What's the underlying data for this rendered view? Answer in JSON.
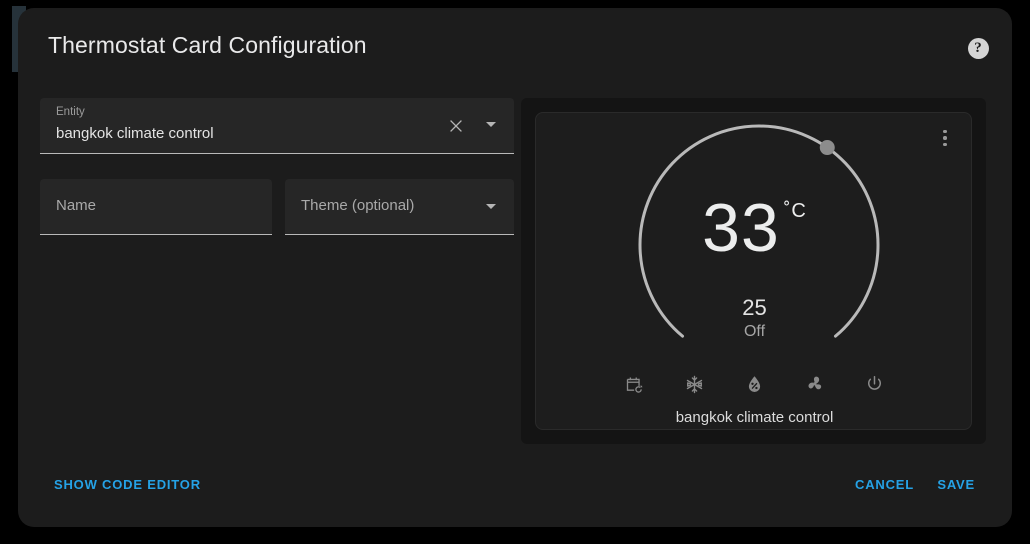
{
  "dialog": {
    "title": "Thermostat Card Configuration",
    "help_icon": "help-circle-icon",
    "help_glyph": "?"
  },
  "form": {
    "entity": {
      "label": "Entity",
      "value": "bangkok climate control",
      "clear_icon": "close-icon",
      "dropdown_icon": "chevron-down-icon"
    },
    "name": {
      "placeholder": "Name",
      "value": ""
    },
    "theme": {
      "placeholder": "Theme (optional)",
      "value": "",
      "dropdown_icon": "chevron-down-icon"
    }
  },
  "preview": {
    "card": {
      "menu_icon": "dots-vertical-icon",
      "current_temp": "33",
      "unit": "˚C",
      "target_temp": "25",
      "hvac_state": "Off",
      "entity_name": "bangkok climate control",
      "dial": {
        "arc_color": "#b9b9b9",
        "handle_color": "#8c8c8c",
        "start_angle_deg": 130,
        "sweep_deg": 280,
        "handle_angle_deg": 50
      },
      "modes": [
        {
          "icon": "calendar-sync-icon",
          "label": "Auto"
        },
        {
          "icon": "snowflake-icon",
          "label": "Cool"
        },
        {
          "icon": "water-percent-icon",
          "label": "Dry"
        },
        {
          "icon": "fan-icon",
          "label": "Fan only"
        },
        {
          "icon": "power-icon",
          "label": "Off"
        }
      ]
    }
  },
  "footer": {
    "show_code_editor": "SHOW CODE EDITOR",
    "cancel": "CANCEL",
    "save": "SAVE",
    "accent_color": "#25a2e6"
  }
}
